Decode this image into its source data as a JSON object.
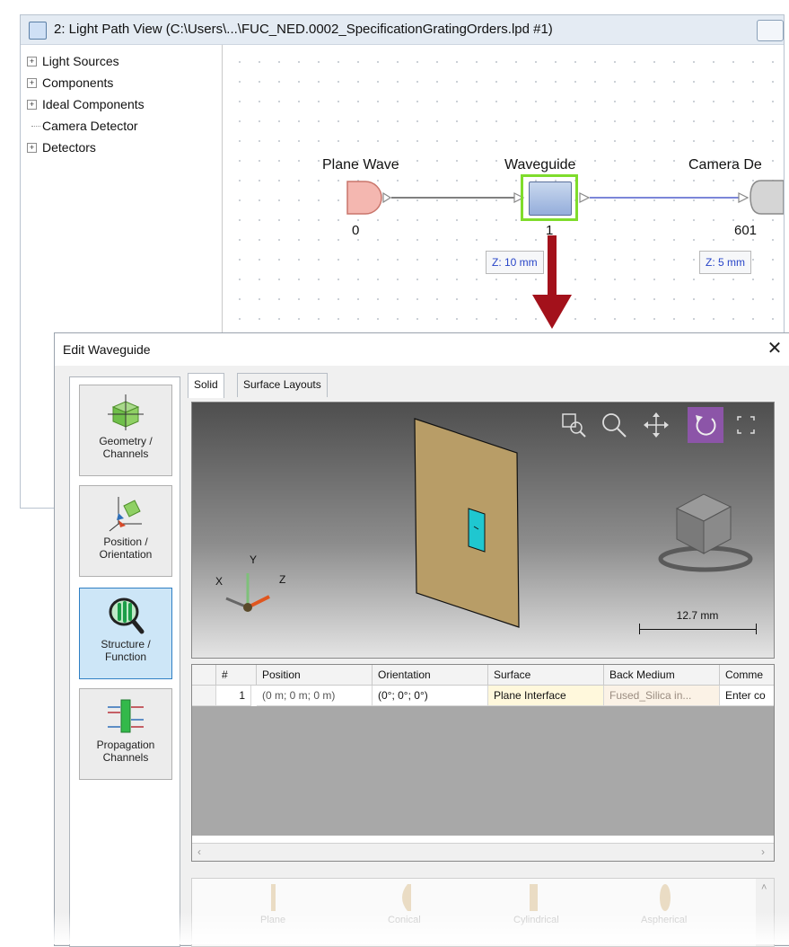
{
  "light_path_window": {
    "title": "2: Light Path View (C:\\Users\\...\\FUC_NED.0002_SpecificationGratingOrders.lpd #1)",
    "tree": [
      {
        "label": "Light Sources",
        "expandable": true
      },
      {
        "label": "Components",
        "expandable": true
      },
      {
        "label": "Ideal Components",
        "expandable": true
      },
      {
        "label": "Camera Detector",
        "expandable": false
      },
      {
        "label": "Detectors",
        "expandable": true
      }
    ],
    "nodes": {
      "plane_wave": {
        "label": "Plane Wave",
        "index": "0"
      },
      "waveguide": {
        "label": "Waveguide",
        "index": "1",
        "z": "Z: 10 mm"
      },
      "camera_detector": {
        "label": "Camera De",
        "index": "601",
        "z": "Z: 5 mm"
      }
    },
    "colors": {
      "source": "#f4b7b0",
      "waveguide": "#aec3df",
      "selection": "#7fdc2c",
      "wire_out": "#7b86d8"
    }
  },
  "dialog": {
    "title": "Edit Waveguide",
    "close_icon": "close-icon",
    "nav": [
      {
        "label": "Geometry /\nChannels",
        "icon": "geometry-channels-icon",
        "active": false
      },
      {
        "label": "Position /\nOrientation",
        "icon": "position-orientation-icon",
        "active": false
      },
      {
        "label": "Structure /\nFunction",
        "icon": "structure-function-icon",
        "active": true
      },
      {
        "label": "Propagation\nChannels",
        "icon": "propagation-channels-icon",
        "active": false
      }
    ],
    "tabs": [
      {
        "label": "Solid",
        "selected": true
      },
      {
        "label": "Surface Layouts",
        "selected": false
      }
    ],
    "view3d": {
      "tools": [
        "zoom-window-icon",
        "zoom-icon",
        "pan-icon",
        "rotate-icon",
        "fit-icon"
      ],
      "active_tool": "rotate-icon",
      "axes": {
        "x": "X",
        "y": "Y",
        "z": "Z"
      },
      "scale_bar": "12.7 mm",
      "plate_color": "#b89d67",
      "highlight_color": "#1fc7d0"
    },
    "grid": {
      "columns": [
        "#",
        "Position",
        "Orientation",
        "Surface",
        "Back Medium",
        "Comme"
      ],
      "rows": [
        {
          "num": "1",
          "position": "(0 m; 0 m; 0 m)",
          "orientation": "(0°; 0°; 0°)",
          "surface": "Plane Interface",
          "back_medium": "Fused_Silica in...",
          "comment": "Enter co"
        }
      ]
    },
    "library": [
      "Plane",
      "Conical",
      "Cylindrical",
      "Aspherical"
    ]
  }
}
